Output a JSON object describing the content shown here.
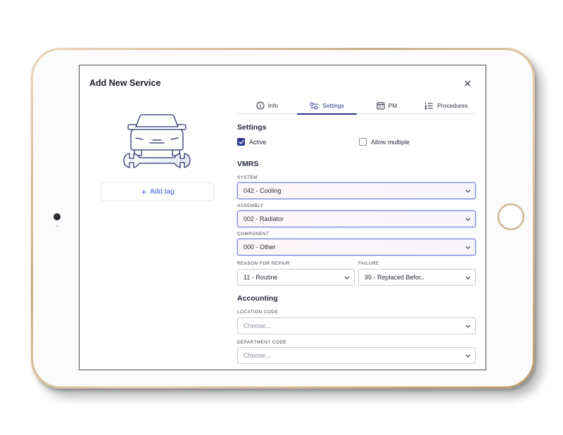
{
  "modal": {
    "title": "Add New Service",
    "close_icon": "close-icon"
  },
  "left": {
    "illustration_icon": "car-wrench-icon",
    "add_tag_label": "Add tag"
  },
  "tabs": [
    {
      "label": "Info",
      "icon": "info-icon",
      "active": false
    },
    {
      "label": "Settings",
      "icon": "sliders-icon",
      "active": true
    },
    {
      "label": "PM",
      "icon": "calendar-icon",
      "active": false
    },
    {
      "label": "Procedures",
      "icon": "list-icon",
      "active": false
    }
  ],
  "settings": {
    "title": "Settings",
    "active_label": "Active",
    "active_checked": true,
    "allow_multiple_label": "Allow multiple",
    "allow_multiple_checked": false
  },
  "vmrs": {
    "title": "VMRS",
    "system": {
      "label": "SYSTEM",
      "value": "042 - Cooling"
    },
    "assembly": {
      "label": "ASSEMBLY",
      "value": "002 - Radiator"
    },
    "component": {
      "label": "COMPONENT",
      "value": "000 - Other"
    },
    "reason": {
      "label": "REASON FOR REPAIR",
      "value": "11 - Routine"
    },
    "failure": {
      "label": "FAILURE",
      "value": "99 - Replaced Befor.."
    }
  },
  "accounting": {
    "title": "Accounting",
    "location": {
      "label": "LOCATION CODE",
      "placeholder": "Choose..."
    },
    "department": {
      "label": "DEPARTMENT CODE",
      "placeholder": "Choose..."
    }
  },
  "colors": {
    "accent": "#2f3a8f",
    "link": "#3a5bd9",
    "device_frame": "#c9ad82",
    "focus_border": "#6c7ce0"
  }
}
